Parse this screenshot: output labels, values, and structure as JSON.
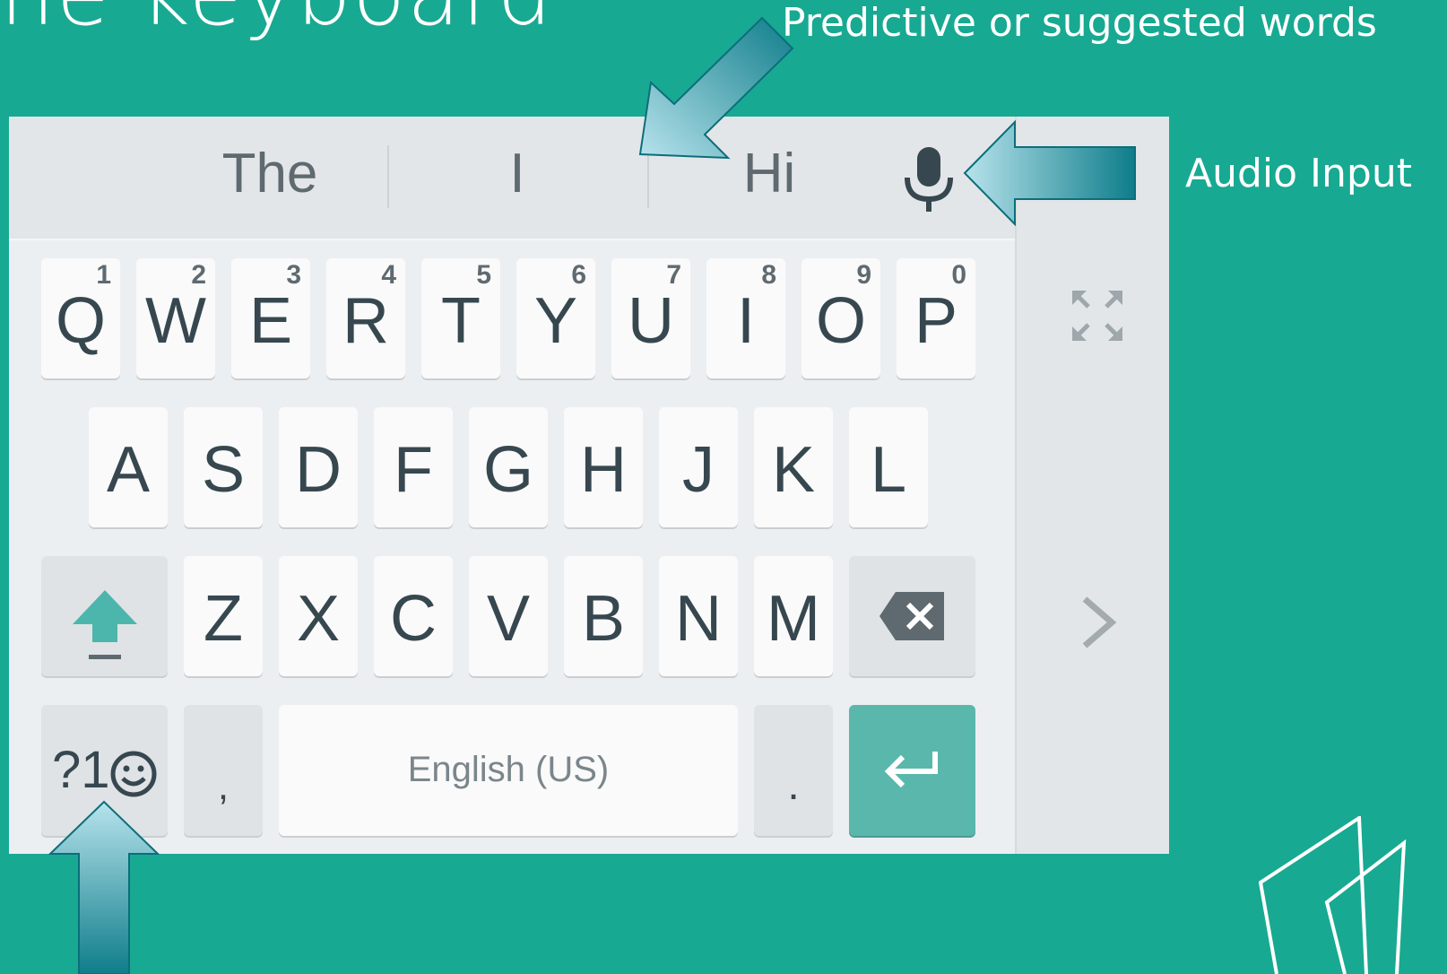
{
  "slide": {
    "title": "he keyboard"
  },
  "annotations": {
    "predictive": "Predictive or suggested words",
    "audio": "Audio Input"
  },
  "suggestions": [
    "The",
    "I",
    "Hi"
  ],
  "keys": {
    "row1": [
      {
        "label": "Q",
        "hint": "1"
      },
      {
        "label": "W",
        "hint": "2"
      },
      {
        "label": "E",
        "hint": "3"
      },
      {
        "label": "R",
        "hint": "4"
      },
      {
        "label": "T",
        "hint": "5"
      },
      {
        "label": "Y",
        "hint": "6"
      },
      {
        "label": "U",
        "hint": "7"
      },
      {
        "label": "I",
        "hint": "8"
      },
      {
        "label": "O",
        "hint": "9"
      },
      {
        "label": "P",
        "hint": "0"
      }
    ],
    "row2": [
      "A",
      "S",
      "D",
      "F",
      "G",
      "H",
      "J",
      "K",
      "L"
    ],
    "row3": [
      "Z",
      "X",
      "C",
      "V",
      "B",
      "N",
      "M"
    ],
    "symbols": "?1",
    "comma": ",",
    "space": "English (US)",
    "period": "."
  },
  "colors": {
    "background": "#18a992",
    "keyboard": "#eceff1",
    "key": "#fafafa",
    "key_text": "#37474f",
    "accent": "#4db6ac",
    "enter_key": "#5ab7ac"
  },
  "icons": {
    "mic": "microphone-icon",
    "fullscreen": "expand-icon",
    "next": "chevron-right-icon",
    "shift": "shift-arrow-icon",
    "backspace": "backspace-icon",
    "enter": "enter-icon",
    "emoji": "smiley-icon"
  }
}
